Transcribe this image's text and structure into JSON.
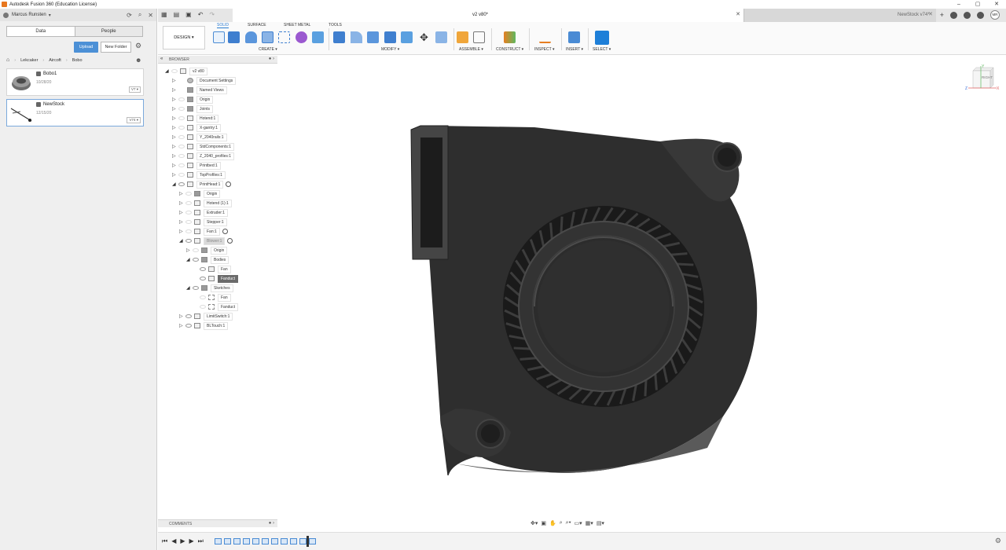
{
  "window": {
    "title": "Autodesk Fusion 360 (Education License)",
    "controls": [
      "–",
      "▢",
      "✕"
    ]
  },
  "data_panel": {
    "user": "Marcus Runsten",
    "tabs": [
      "Data",
      "People"
    ],
    "upload_label": "Upload",
    "new_folder_label": "New Folder",
    "breadcrumbs": [
      "Lekcaker",
      "Aircoft",
      "Bobo"
    ],
    "files": [
      {
        "name": "Bobo1",
        "date": "10/28/20",
        "version": "V7 ▾"
      },
      {
        "name": "NewStock",
        "date": "12/15/20",
        "version": "V74 ▾"
      }
    ]
  },
  "doc_tabs": {
    "active": {
      "label": "v2 v80*"
    },
    "inactive": {
      "label": "NewStock v74*"
    },
    "avatar": "MR"
  },
  "ribbon": {
    "workspace": "DESIGN ▾",
    "tabs": [
      "SOLID",
      "SURFACE",
      "SHEET METAL",
      "TOOLS"
    ],
    "active_tab": "SOLID",
    "groups": [
      "CREATE ▾",
      "MODIFY ▾",
      "ASSEMBLE ▾",
      "CONSTRUCT ▾",
      "INSPECT ▾",
      "INSERT ▾",
      "SELECT ▾"
    ]
  },
  "browser": {
    "title": "BROWSER",
    "items": [
      {
        "label": "v2 v80",
        "depth": 0,
        "arrow": "◢",
        "style": "normal",
        "icon": "doc",
        "eye": "faint"
      },
      {
        "label": "Document Settings",
        "depth": 1,
        "arrow": "▷",
        "style": "normal",
        "icon": "gear",
        "eye": "none"
      },
      {
        "label": "Named Views",
        "depth": 1,
        "arrow": "▷",
        "style": "normal",
        "icon": "folder",
        "eye": "none"
      },
      {
        "label": "Origin",
        "depth": 1,
        "arrow": "▷",
        "style": "normal",
        "icon": "folder",
        "eye": "faint"
      },
      {
        "label": "Joints",
        "depth": 1,
        "arrow": "▷",
        "style": "normal",
        "icon": "folder",
        "eye": "faint"
      },
      {
        "label": "Hotend:1",
        "depth": 1,
        "arrow": "▷",
        "style": "normal",
        "icon": "doc",
        "eye": "faint"
      },
      {
        "label": "X-gantry:1",
        "depth": 1,
        "arrow": "▷",
        "style": "normal",
        "icon": "doc",
        "eye": "faint"
      },
      {
        "label": "Y_2040rails:1",
        "depth": 1,
        "arrow": "▷",
        "style": "normal",
        "icon": "doc",
        "eye": "faint"
      },
      {
        "label": "StdComponents:1",
        "depth": 1,
        "arrow": "▷",
        "style": "normal",
        "icon": "doc",
        "eye": "faint"
      },
      {
        "label": "Z_2040_profiles:1",
        "depth": 1,
        "arrow": "▷",
        "style": "normal",
        "icon": "doc",
        "eye": "faint"
      },
      {
        "label": "Printbed:1",
        "depth": 1,
        "arrow": "▷",
        "style": "normal",
        "icon": "doc",
        "eye": "faint"
      },
      {
        "label": "TopProfiles:1",
        "depth": 1,
        "arrow": "▷",
        "style": "normal",
        "icon": "doc",
        "eye": "faint"
      },
      {
        "label": "PrintHead:1",
        "depth": 1,
        "arrow": "◢",
        "style": "normal",
        "icon": "doc",
        "eye": "on",
        "badge": true
      },
      {
        "label": "Origin",
        "depth": 2,
        "arrow": "▷",
        "style": "normal",
        "icon": "folder",
        "eye": "faint"
      },
      {
        "label": "Hotend (1):1",
        "depth": 2,
        "arrow": "▷",
        "style": "normal",
        "icon": "doc",
        "eye": "faint"
      },
      {
        "label": "Extruder:1",
        "depth": 2,
        "arrow": "▷",
        "style": "normal",
        "icon": "doc",
        "eye": "faint"
      },
      {
        "label": "Stepper:1",
        "depth": 2,
        "arrow": "▷",
        "style": "normal",
        "icon": "doc",
        "eye": "faint"
      },
      {
        "label": "Fan:1",
        "depth": 2,
        "arrow": "▷",
        "style": "normal",
        "icon": "doc",
        "eye": "faint",
        "badge": true
      },
      {
        "label": "Blower:1",
        "depth": 2,
        "arrow": "◢",
        "style": "sel",
        "icon": "doc",
        "eye": "on",
        "badge": true
      },
      {
        "label": "Origin",
        "depth": 3,
        "arrow": "▷",
        "style": "normal",
        "icon": "folder",
        "eye": "faint"
      },
      {
        "label": "Bodies",
        "depth": 3,
        "arrow": "◢",
        "style": "normal",
        "icon": "folder",
        "eye": "on"
      },
      {
        "label": "Fan",
        "depth": 4,
        "arrow": "",
        "style": "normal",
        "icon": "doc",
        "eye": "on"
      },
      {
        "label": "Fanduct",
        "depth": 4,
        "arrow": "",
        "style": "hl",
        "icon": "doc",
        "eye": "on"
      },
      {
        "label": "Sketches",
        "depth": 3,
        "arrow": "◢",
        "style": "normal",
        "icon": "folder",
        "eye": "on"
      },
      {
        "label": "Fan",
        "depth": 4,
        "arrow": "",
        "style": "normal",
        "icon": "sketch",
        "eye": "faint"
      },
      {
        "label": "Fanduct",
        "depth": 4,
        "arrow": "",
        "style": "normal",
        "icon": "sketch",
        "eye": "faint"
      },
      {
        "label": "LimitSwitch:1",
        "depth": 2,
        "arrow": "▷",
        "style": "normal",
        "icon": "doc",
        "eye": "on"
      },
      {
        "label": "BLTouch:1",
        "depth": 2,
        "arrow": "▷",
        "style": "normal",
        "icon": "doc",
        "eye": "on"
      }
    ]
  },
  "comments": {
    "title": "COMMENTS"
  },
  "viewcube": {
    "face": "RIGHT",
    "axis_z": "Z",
    "axis_x": "X",
    "axis_y": "Y"
  },
  "colors": {
    "accent": "#4c90d6",
    "model": "#3a3a3a",
    "highlight": "#6b6b6b"
  }
}
